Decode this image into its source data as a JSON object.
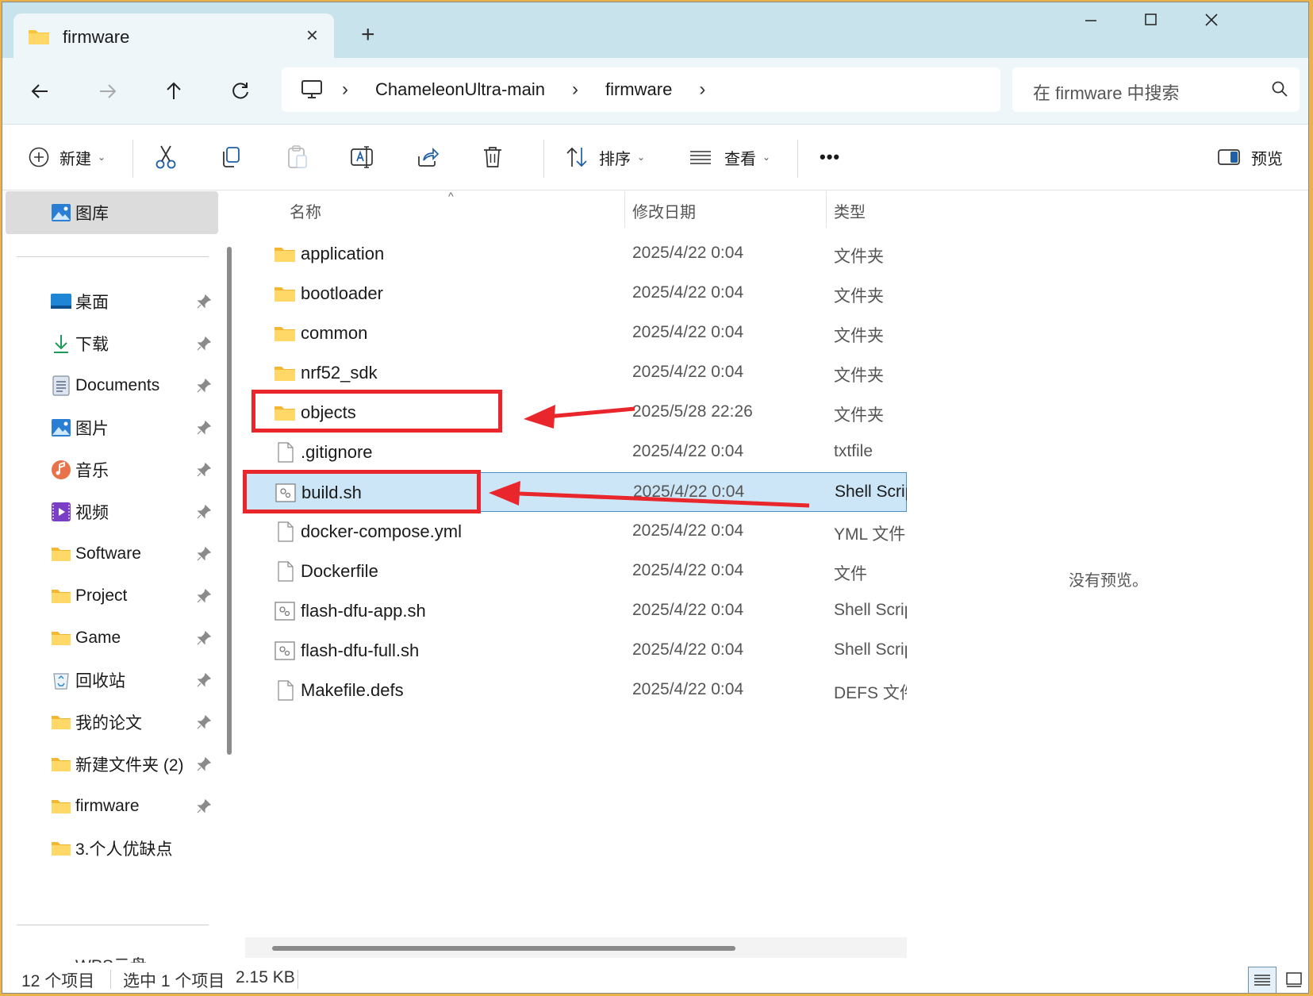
{
  "window": {
    "tab_title": "firmware",
    "new_tab_symbol": "+"
  },
  "nav": {
    "breadcrumb": [
      "ChameleonUltra-main",
      "firmware"
    ],
    "search_placeholder": "在 firmware 中搜索"
  },
  "toolbar": {
    "new_label": "新建",
    "sort_label": "排序",
    "view_label": "查看",
    "more_label": "•••",
    "preview_label": "预览"
  },
  "sidebar": {
    "gallery_label": "图库",
    "items": [
      {
        "label": "桌面",
        "icon": "desktop-icon",
        "pinned": true
      },
      {
        "label": "下载",
        "icon": "download-icon",
        "pinned": true
      },
      {
        "label": "Documents",
        "icon": "documents-icon",
        "pinned": true
      },
      {
        "label": "图片",
        "icon": "pictures-icon",
        "pinned": true
      },
      {
        "label": "音乐",
        "icon": "music-icon",
        "pinned": true
      },
      {
        "label": "视频",
        "icon": "video-icon",
        "pinned": true
      },
      {
        "label": "Software",
        "icon": "folder-icon",
        "pinned": true
      },
      {
        "label": "Project",
        "icon": "folder-icon",
        "pinned": true
      },
      {
        "label": "Game",
        "icon": "folder-icon",
        "pinned": true
      },
      {
        "label": "回收站",
        "icon": "recycle-bin-icon",
        "pinned": true
      },
      {
        "label": "我的论文",
        "icon": "folder-icon",
        "pinned": true
      },
      {
        "label": "新建文件夹 (2)",
        "icon": "folder-icon",
        "pinned": true
      },
      {
        "label": "firmware",
        "icon": "folder-icon",
        "pinned": true
      },
      {
        "label": "3.个人优缺点",
        "icon": "folder-icon",
        "pinned": false
      }
    ],
    "partial_item": "WPS云盘"
  },
  "filelist": {
    "columns": {
      "name": "名称",
      "date": "修改日期",
      "type": "类型"
    },
    "rows": [
      {
        "name": "application",
        "date": "2025/4/22 0:04",
        "type": "文件夹",
        "kind": "folder"
      },
      {
        "name": "bootloader",
        "date": "2025/4/22 0:04",
        "type": "文件夹",
        "kind": "folder"
      },
      {
        "name": "common",
        "date": "2025/4/22 0:04",
        "type": "文件夹",
        "kind": "folder"
      },
      {
        "name": "nrf52_sdk",
        "date": "2025/4/22 0:04",
        "type": "文件夹",
        "kind": "folder"
      },
      {
        "name": "objects",
        "date": "2025/5/28 22:26",
        "type": "文件夹",
        "kind": "folder"
      },
      {
        "name": ".gitignore",
        "date": "2025/4/22 0:04",
        "type": "txtfile",
        "kind": "file"
      },
      {
        "name": "build.sh",
        "date": "2025/4/22 0:04",
        "type": "Shell Script",
        "kind": "script",
        "selected": true
      },
      {
        "name": "docker-compose.yml",
        "date": "2025/4/22 0:04",
        "type": "YML 文件",
        "kind": "file"
      },
      {
        "name": "Dockerfile",
        "date": "2025/4/22 0:04",
        "type": "文件",
        "kind": "file"
      },
      {
        "name": "flash-dfu-app.sh",
        "date": "2025/4/22 0:04",
        "type": "Shell Script",
        "kind": "script"
      },
      {
        "name": "flash-dfu-full.sh",
        "date": "2025/4/22 0:04",
        "type": "Shell Script",
        "kind": "script"
      },
      {
        "name": "Makefile.defs",
        "date": "2025/4/22 0:04",
        "type": "DEFS 文件",
        "kind": "file"
      }
    ]
  },
  "preview": {
    "empty_text": "没有预览。"
  },
  "status": {
    "item_count": "12 个项目",
    "selection": "选中 1 个项目",
    "size": "2.15 KB"
  },
  "colors": {
    "accent": "#0067c0",
    "folder": "#f8c43c",
    "selection": "#cce6f7",
    "annotation_red": "#e8262c"
  }
}
